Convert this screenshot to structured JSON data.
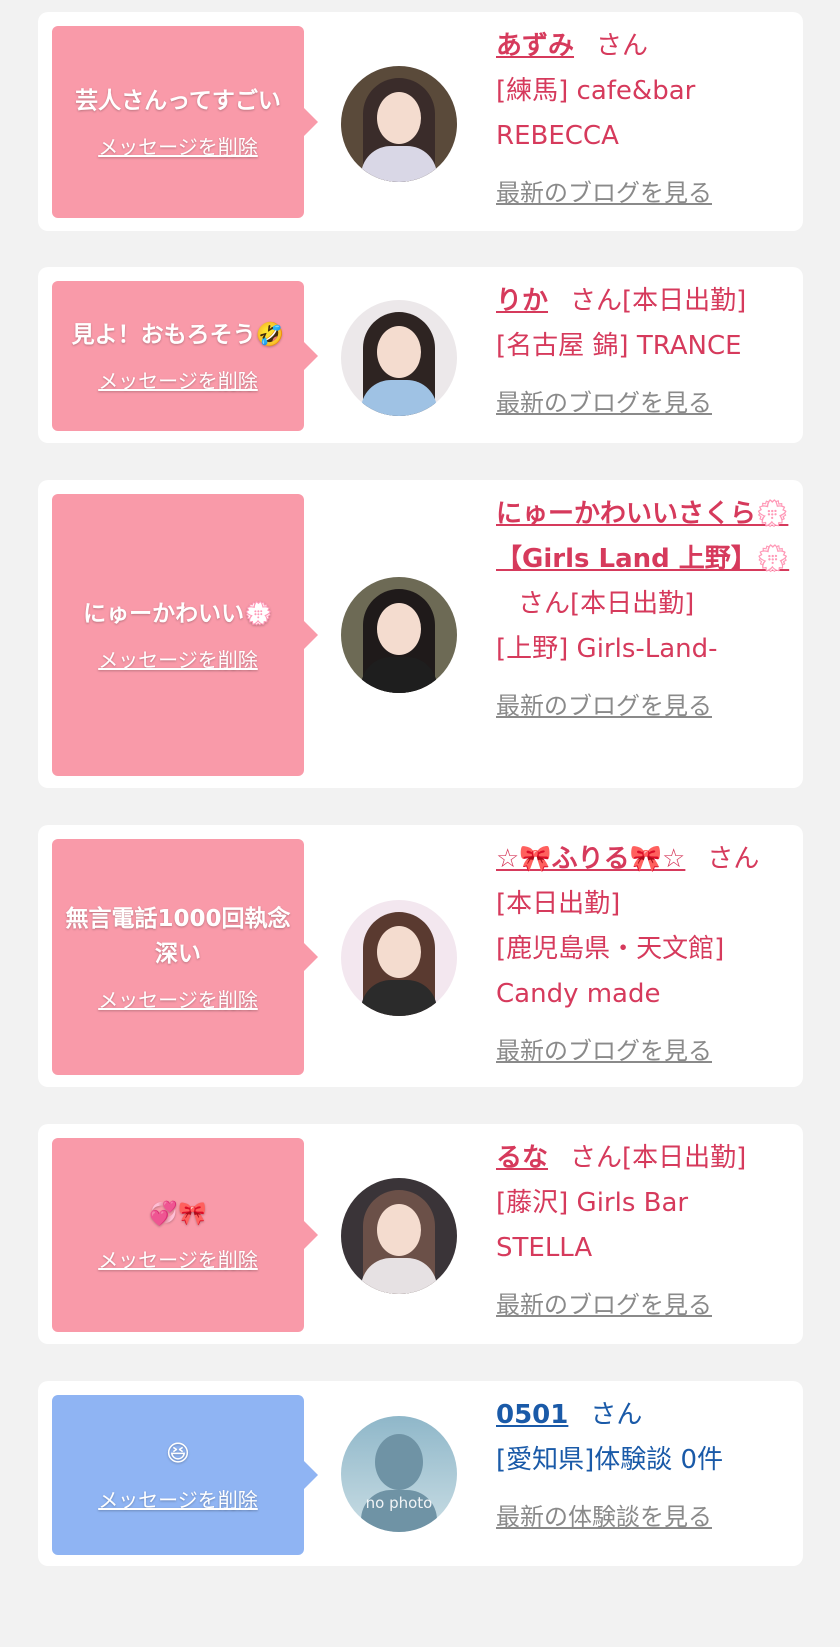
{
  "colors": {
    "pink_bubble": "#f99aa9",
    "blue_bubble": "#8fb4f3",
    "pink_text": "#d63a5c",
    "blue_text": "#1a5aa8",
    "link_gray": "#8a8a8a"
  },
  "delete_label": "メッセージを削除",
  "cards": [
    {
      "message": "芸人さんってすごい",
      "name": "あずみ",
      "suffix": "さん",
      "shop": "[練馬] cafe&bar REBECCA",
      "blog_link": "最新のブログを見る"
    },
    {
      "message": "見よ！おもろそう🤣",
      "name": "りか",
      "suffix": "さん[本日出勤]",
      "shop": "[名古屋 錦] TRANCE",
      "blog_link": "最新のブログを見る"
    },
    {
      "message": "にゅーかわいい💮",
      "name": "にゅーかわいいさくら💮【Girls Land 上野】💮",
      "suffix": "さん[本日出勤]",
      "shop": "[上野] Girls-Land-",
      "blog_link": "最新のブログを見る"
    },
    {
      "message": "無言電話1000回執念深い",
      "name": "☆🎀ふりる🎀☆",
      "suffix": "さん[本日出勤]",
      "shop": "[鹿児島県・天文館] Candy made",
      "blog_link": "最新のブログを見る"
    },
    {
      "message": "💞🎀",
      "name": "るな",
      "suffix": "さん[本日出勤]",
      "shop": "[藤沢] Girls Bar STELLA",
      "blog_link": "最新のブログを見る"
    },
    {
      "message": "😆",
      "name": "0501",
      "suffix": "さん",
      "shop": "[愛知県]体験談 0件",
      "blog_link": "最新の体験談を見る",
      "avatar_text": "no photo"
    }
  ]
}
